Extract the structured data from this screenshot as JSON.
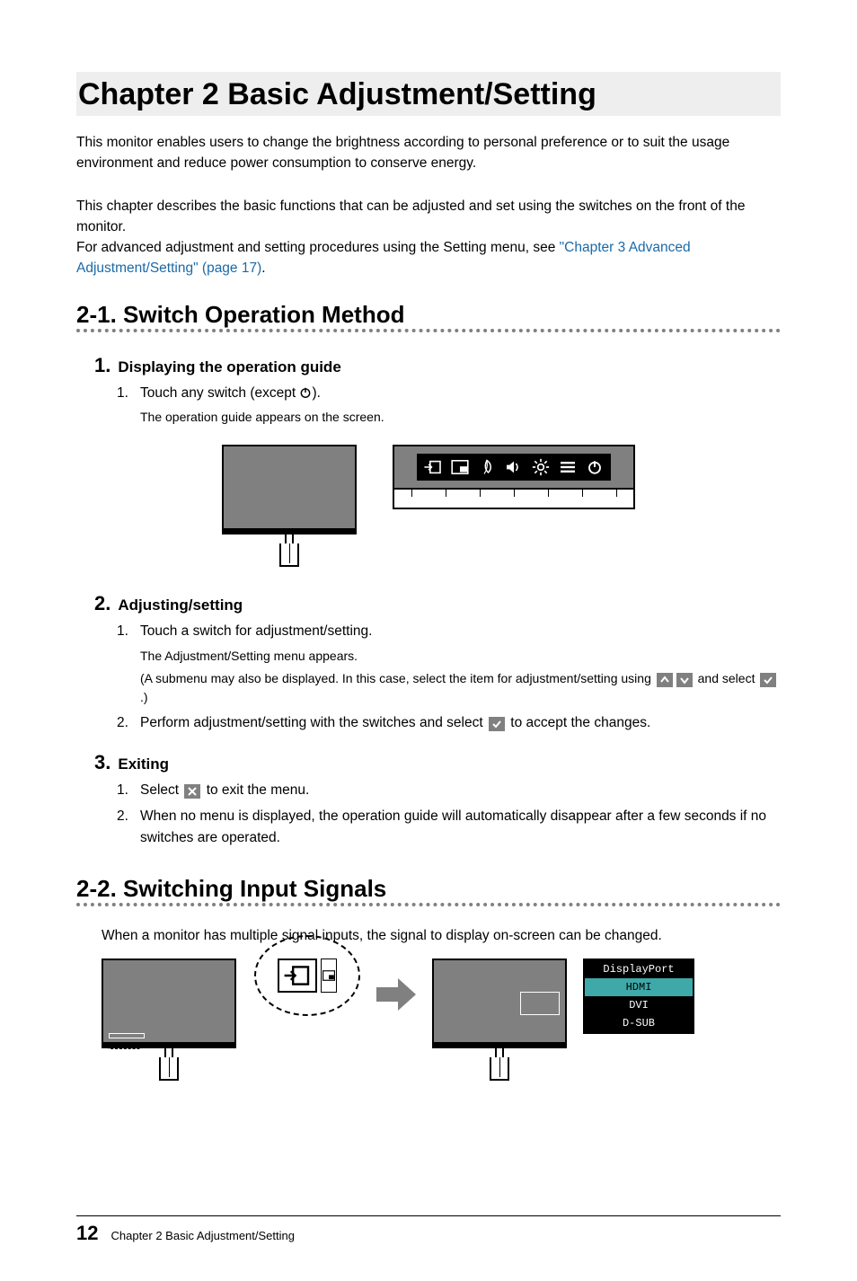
{
  "chapter_title": "Chapter 2   Basic Adjustment/Setting",
  "intro": {
    "p1": "This monitor enables users to change the brightness according to personal preference or to suit the usage environment and reduce power consumption to conserve energy.",
    "p2a": "This chapter describes the basic functions that can be adjusted and set using the switches on the front of the monitor.",
    "p2b_prefix": "For advanced adjustment and setting procedures using the Setting menu, see ",
    "p2b_link": "\"Chapter 3 Advanced Adjustment/Setting\" (page 17)",
    "p2b_suffix": "."
  },
  "section_2_1": {
    "heading": "2-1.  Switch Operation Method",
    "sub1": {
      "num": "1.",
      "title": "Displaying the operation guide",
      "steps": [
        {
          "n": "1.",
          "text_before": "Touch any switch (except ",
          "text_after": ")."
        }
      ],
      "note": "The operation guide appears on the screen.",
      "guide_icons": [
        "input-icon",
        "pip-icon",
        "eco-icon",
        "volume-icon",
        "brightness-icon",
        "menu-icon",
        "power-icon"
      ]
    },
    "sub2": {
      "num": "2.",
      "title": "Adjusting/setting",
      "steps": {
        "s1_n": "1.",
        "s1_text": "Touch a switch for adjustment/setting.",
        "s1_note": "The Adjustment/Setting menu appears.",
        "s1_subnote_before": "(A submenu may also be displayed. In this case, select the item for adjustment/setting using ",
        "s1_subnote_mid": " and select ",
        "s1_subnote_after": ".)",
        "s2_n": "2.",
        "s2_before": "Perform adjustment/setting with the switches and select ",
        "s2_after": " to accept the changes."
      }
    },
    "sub3": {
      "num": "3.",
      "title": "Exiting",
      "s1_n": "1.",
      "s1_before": "Select ",
      "s1_after": " to exit the menu.",
      "s2_n": "2.",
      "s2_text": "When no menu is displayed, the operation guide will automatically disappear after a few seconds if no switches are operated."
    }
  },
  "section_2_2": {
    "heading": "2-2.  Switching Input Signals",
    "intro": "When a monitor has multiple signal inputs, the signal to display on-screen can be changed.",
    "input_menu": {
      "items": [
        "DisplayPort",
        "HDMI",
        "DVI",
        "D-SUB"
      ],
      "selected_index": 1
    }
  },
  "footer": {
    "page_number": "12",
    "text": "Chapter 2 Basic Adjustment/Setting"
  }
}
